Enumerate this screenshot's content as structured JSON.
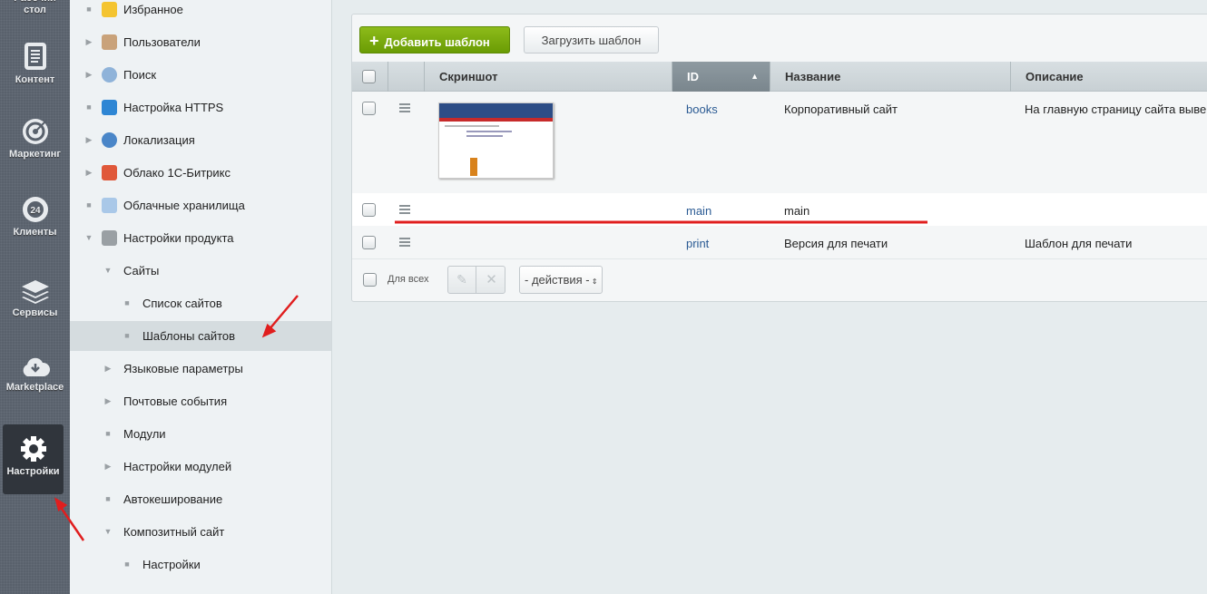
{
  "leftbar": {
    "items": [
      {
        "label": "Рабочий стол",
        "icon": "desktop-icon"
      },
      {
        "label": "Контент",
        "icon": "document-icon"
      },
      {
        "label": "Маркетинг",
        "icon": "target-icon"
      },
      {
        "label": "Клиенты",
        "icon": "crm-24-icon"
      },
      {
        "label": "Сервисы",
        "icon": "layers-icon"
      },
      {
        "label": "Marketplace",
        "icon": "cloud-download-icon"
      },
      {
        "label": "Настройки",
        "icon": "gear-icon",
        "active": true
      }
    ]
  },
  "menu": {
    "items": [
      {
        "label": "Избранное",
        "marker": "bullet",
        "icon": "star-icon"
      },
      {
        "label": "Пользователи",
        "marker": "arrow-right",
        "icon": "user-icon"
      },
      {
        "label": "Поиск",
        "marker": "arrow-right",
        "icon": "search-icon"
      },
      {
        "label": "Настройка HTTPS",
        "marker": "bullet",
        "icon": "lock-icon"
      },
      {
        "label": "Локализация",
        "marker": "arrow-right",
        "icon": "globe-icon"
      },
      {
        "label": "Облако 1С-Битрикс",
        "marker": "arrow-right",
        "icon": "cloud-icon"
      },
      {
        "label": "Облачные хранилища",
        "marker": "bullet",
        "icon": "cloud-storage-icon"
      },
      {
        "label": "Настройки продукта",
        "marker": "arrow-down",
        "icon": "gear-icon"
      },
      {
        "label": "Сайты",
        "marker": "arrow-down",
        "level": 1
      },
      {
        "label": "Список сайтов",
        "marker": "bullet",
        "level": 2
      },
      {
        "label": "Шаблоны сайтов",
        "marker": "bullet",
        "level": 2,
        "selected": true
      },
      {
        "label": "Языковые параметры",
        "marker": "arrow-right",
        "level": 1
      },
      {
        "label": "Почтовые события",
        "marker": "arrow-right",
        "level": 1
      },
      {
        "label": "Модули",
        "marker": "bullet",
        "level": 1
      },
      {
        "label": "Настройки модулей",
        "marker": "arrow-right",
        "level": 1
      },
      {
        "label": "Автокеширование",
        "marker": "bullet",
        "level": 1
      },
      {
        "label": "Композитный сайт",
        "marker": "arrow-down",
        "level": 1
      },
      {
        "label": "Настройки",
        "marker": "bullet",
        "level": 2
      }
    ]
  },
  "toolbar": {
    "add_label": "Добавить шаблон",
    "load_label": "Загрузить шаблон"
  },
  "table": {
    "columns": [
      "Скриншот",
      "ID",
      "Название",
      "Описание"
    ],
    "sort_column": "ID",
    "sort_dir": "asc",
    "rows": [
      {
        "id": "books",
        "name": "Корпоративный сайт",
        "description": "На главную страницу сайта выве",
        "has_screenshot": true
      },
      {
        "id": "main",
        "name": "main",
        "description": ""
      },
      {
        "id": "print",
        "name": "Версия для печати",
        "description": "Шаблон для печати"
      }
    ]
  },
  "footer": {
    "for_all_label": "Для всех",
    "actions_value": "- действия -"
  },
  "colors": {
    "accent_green": "#7aab0c",
    "annotation_red": "#e01e1e",
    "link": "#2a5a93"
  }
}
